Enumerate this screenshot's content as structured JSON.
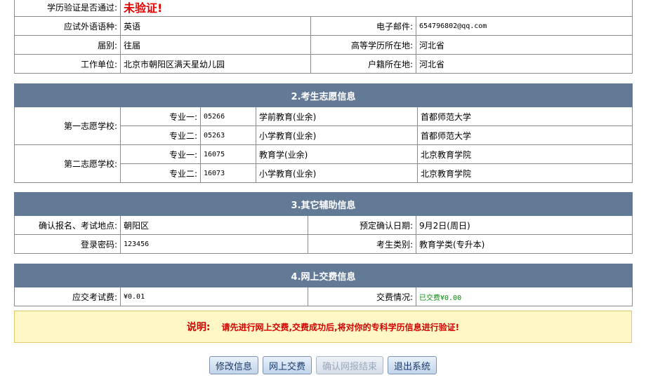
{
  "personal": {
    "edu_verify_label": "学历验证是否通过:",
    "edu_verify_value": "未验证!",
    "foreign_lang_label": "应试外语语种:",
    "foreign_lang_value": "英语",
    "email_label": "电子邮件:",
    "email_value": "654796802@qq.com",
    "grad_type_label": "届别:",
    "grad_type_value": "往届",
    "edu_location_label": "高等学历所在地:",
    "edu_location_value": "河北省",
    "work_unit_label": "工作单位:",
    "work_unit_value": "北京市朝阳区满天星幼儿园",
    "hukou_label": "户籍所在地:",
    "hukou_value": "河北省"
  },
  "wishes": {
    "title": "2.考生志愿信息",
    "schools": [
      {
        "label": "第一志愿学校:",
        "majors": [
          {
            "label": "专业一:",
            "code": "05266",
            "name": "学前教育(业余)",
            "school": "首都师范大学"
          },
          {
            "label": "专业二:",
            "code": "05263",
            "name": "小学教育(业余)",
            "school": "首都师范大学"
          }
        ]
      },
      {
        "label": "第二志愿学校:",
        "majors": [
          {
            "label": "专业一:",
            "code": "16075",
            "name": "教育学(业余)",
            "school": "北京教育学院"
          },
          {
            "label": "专业二:",
            "code": "16073",
            "name": "小学教育(业余)",
            "school": "北京教育学院"
          }
        ]
      }
    ]
  },
  "aux": {
    "title": "3.其它辅助信息",
    "confirm_place_label": "确认报名、考试地点:",
    "confirm_place_value": "朝阳区",
    "confirm_date_label": "预定确认日期:",
    "confirm_date_value": "9月2日(周日)",
    "password_label": "登录密码:",
    "password_value": "123456",
    "category_label": "考生类别:",
    "category_value": "教育学类(专升本)"
  },
  "payment": {
    "title": "4.网上交费信息",
    "fee_label": "应交考试费:",
    "fee_value": "¥0.01",
    "status_label": "交费情况:",
    "status_value": "已交费¥0.00"
  },
  "note": {
    "title": "说明:",
    "text": "请先进行网上交费,交费成功后,将对你的专科学历信息进行验证!"
  },
  "buttons": {
    "edit": "修改信息",
    "pay": "网上交费",
    "confirm": "确认网报结束",
    "exit": "退出系统"
  },
  "colors": {
    "section_header": "#637a96",
    "warning_red": "#e60000",
    "paid_green": "#0a8a0a",
    "note_bg": "#fff8c6"
  }
}
